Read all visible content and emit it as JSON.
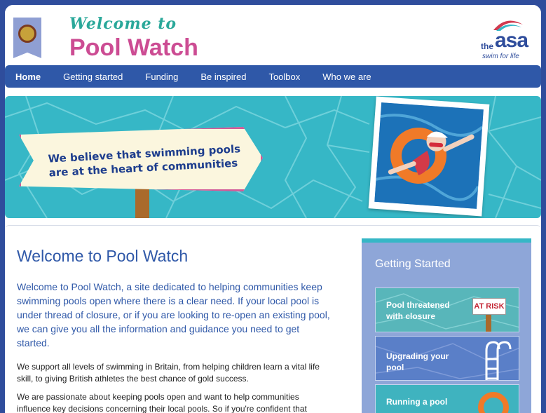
{
  "header": {
    "welcome_script": "Welcome to",
    "title": "Pool Watch",
    "logo": {
      "the": "the",
      "name": "asa",
      "tagline": "swim for life"
    }
  },
  "nav": {
    "items": [
      {
        "label": "Home",
        "active": true
      },
      {
        "label": "Getting started"
      },
      {
        "label": "Funding"
      },
      {
        "label": "Be inspired"
      },
      {
        "label": "Toolbox"
      },
      {
        "label": "Who we are"
      }
    ]
  },
  "banner": {
    "sign_text": "We believe that swimming pools are at the heart of communities"
  },
  "main": {
    "title": "Welcome to Pool Watch",
    "lead": "Welcome to Pool Watch, a site dedicated to helping communities keep swimming pools open where there is a clear need. If your local pool is under thread of closure, or if you are looking to re-open an existing pool, we can give you all the information and guidance you need to get started.",
    "para1": "We support all levels of swimming in Britain, from helping children learn a vital life skill, to giving British athletes the best chance of gold success.",
    "para2": "We are passionate about keeping pools open and want to help communities influence key decisions concerning their local pools. So if you're confident that"
  },
  "sidebar": {
    "title": "Getting Started",
    "cards": [
      {
        "label": "Pool threatened with closure",
        "badge": "AT RISK"
      },
      {
        "label": "Upgrading your pool"
      },
      {
        "label": "Running a pool"
      }
    ]
  },
  "colors": {
    "brand_blue": "#2f58a8",
    "pink": "#cc4c93",
    "teal": "#36b7c6",
    "frame": "#2f4d9c"
  }
}
